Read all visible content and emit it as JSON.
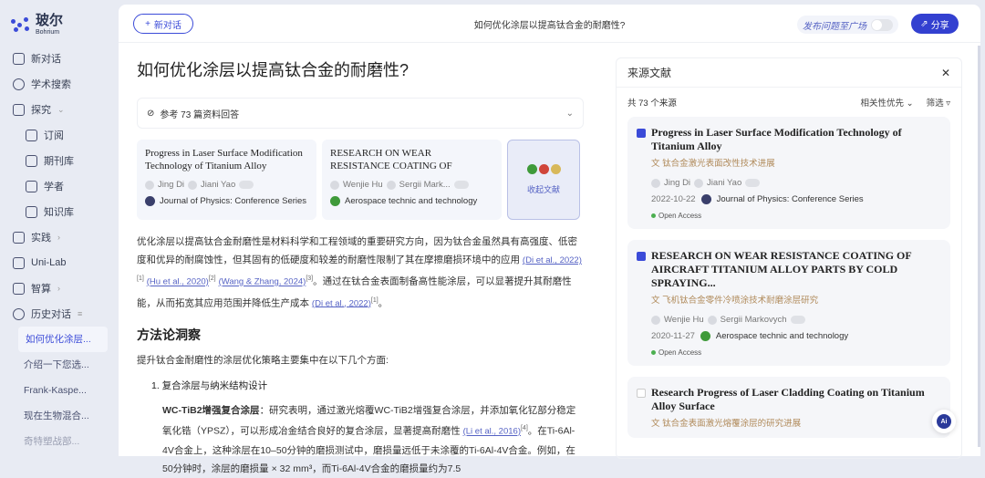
{
  "brand": {
    "name": "玻尔",
    "sub": "Bohrium"
  },
  "sidebar": {
    "items": [
      {
        "label": "新对话"
      },
      {
        "label": "学术搜索"
      },
      {
        "label": "探究"
      },
      {
        "label": "订阅"
      },
      {
        "label": "期刊库"
      },
      {
        "label": "学者"
      },
      {
        "label": "知识库"
      },
      {
        "label": "实践"
      },
      {
        "label": "Uni-Lab"
      },
      {
        "label": "智算"
      },
      {
        "label": "历史对话"
      }
    ],
    "history": [
      "如何优化涂层...",
      "介绍一下您选...",
      "Frank-Kaspe...",
      "现在生物混合...",
      "奇特塑战部..."
    ]
  },
  "topbar": {
    "new_chat": "新对话",
    "title": "如何优化涂层以提高钛合金的耐磨性?",
    "publish": "发布问题至广场",
    "share": "分享"
  },
  "main": {
    "question": "如何优化涂层以提高钛合金的耐磨性?",
    "ref_summary": "参考 73 篇资料回答",
    "cards": [
      {
        "title": "Progress in Laser Surface Modification Technology of Titanium Alloy",
        "authors": [
          "Jing Di",
          "Jiani Yao"
        ],
        "journal": "Journal of Physics: Conference Series"
      },
      {
        "title": "RESEARCH ON WEAR RESISTANCE COATING OF AIRCRAFT TITANIUM...",
        "authors": [
          "Wenjie Hu",
          "Sergii Mark..."
        ],
        "journal": "Aerospace technic and technology"
      }
    ],
    "collect": "收起文献",
    "para1": "优化涂层以提高钛合金耐磨性是材料科学和工程领域的重要研究方向，因为钛合金虽然具有高强度、低密度和优异的耐腐蚀性，但其固有的低硬度和较差的耐磨性限制了其在摩擦磨损环境中的应用",
    "cite1": "(Di et al., 2022)",
    "sup1": "[1]",
    "cite2": "(Hu et al., 2020)",
    "sup2": "[2]",
    "cite3": "(Wang & Zhang, 2024)",
    "sup3": "[3]",
    "para1b": "。通过在钛合金表面制备高性能涂层，可以显著提升其耐磨性能，从而拓宽其应用范围并降低生产成本",
    "cite4": "(Di et al., 2022)",
    "sup4": "[1]",
    "end": "。",
    "h2": "方法论洞察",
    "intro": "提升钛合金耐磨性的涂层优化策略主要集中在以下几个方面:",
    "li1": "1. 复合涂层与纳米结构设计",
    "bold": "WC-TiB2增强复合涂层",
    "sub_text": "：研究表明，通过激光熔覆WC-TiB2增强复合涂层，并添加氧化钇部分稳定氧化锆（YPSZ），可以形成冶金结合良好的复合涂层，显著提高耐磨性",
    "cite5": "(Li et al., 2016)",
    "sup5": "[4]",
    "sub_text2": "。在Ti-6Al-4V合金上，这种涂层在10–50分钟的磨损测试中，磨损量远低于未涂覆的Ti-6Al-4V合金。例如，在50分钟时，涂层的磨损量 × 32 mm³，而Ti-6Al-4V合金的磨损量约为7.5"
  },
  "sources": {
    "title": "来源文献",
    "count": "共 73 个来源",
    "sort": "相关性优先",
    "filter": "筛选",
    "items": [
      {
        "title": "Progress in Laser Surface Modification Technology of Titanium Alloy",
        "zh": "钛合金激光表面改性技术进展",
        "authors": [
          "Jing Di",
          "Jiani Yao"
        ],
        "date": "2022-10-22",
        "journal": "Journal of Physics: Conference Series",
        "oa": "Open Access",
        "checked": true
      },
      {
        "title": "RESEARCH ON WEAR RESISTANCE COATING OF AIRCRAFT TITANIUM ALLOY PARTS BY COLD SPRAYING...",
        "zh": "飞机钛合金零件冷喷涂技术耐磨涂层研究",
        "authors": [
          "Wenjie Hu",
          "Sergii Markovych"
        ],
        "date": "2020-11-27",
        "journal": "Aerospace technic and technology",
        "oa": "Open Access",
        "checked": true
      },
      {
        "title": "Research Progress of Laser Cladding Coating on Titanium Alloy Surface",
        "zh": "钛合金表面激光熔覆涂层的研究进展",
        "checked": false
      }
    ]
  },
  "ai_label": "Ai"
}
